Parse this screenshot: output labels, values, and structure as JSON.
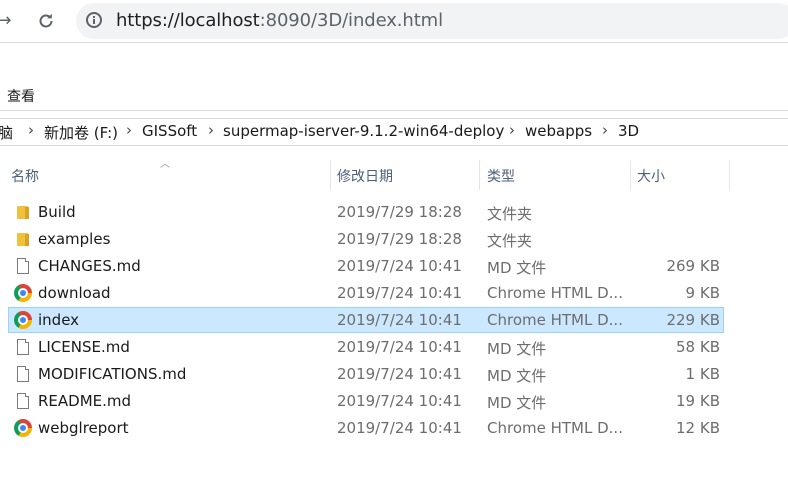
{
  "browser": {
    "back_icon": "arrow-left-icon",
    "reload_icon": "reload-icon",
    "info_icon": "info-icon",
    "url_scheme_host": "https://localhost",
    "url_rest": ":8090/3D/index.html"
  },
  "ribbon": {
    "view_tab": "查看"
  },
  "breadcrumb": {
    "items": [
      "脑",
      "新加卷 (F:)",
      "GISSoft",
      "supermap-iserver-9.1.2-win64-deploy",
      "webapps",
      "3D"
    ]
  },
  "columns": {
    "name": "名称",
    "date": "修改日期",
    "type": "类型",
    "size": "大小"
  },
  "files": [
    {
      "icon": "folder-icon",
      "name": "Build",
      "date": "2019/7/29 18:28",
      "type": "文件夹",
      "size": ""
    },
    {
      "icon": "folder-icon",
      "name": "examples",
      "date": "2019/7/29 18:28",
      "type": "文件夹",
      "size": ""
    },
    {
      "icon": "file-icon",
      "name": "CHANGES.md",
      "date": "2019/7/24 10:41",
      "type": "MD 文件",
      "size": "269 KB"
    },
    {
      "icon": "chrome-icon",
      "name": "download",
      "date": "2019/7/24 10:41",
      "type": "Chrome HTML D...",
      "size": "9 KB"
    },
    {
      "icon": "chrome-icon",
      "name": "index",
      "date": "2019/7/24 10:41",
      "type": "Chrome HTML D...",
      "size": "229 KB",
      "selected": true
    },
    {
      "icon": "file-icon",
      "name": "LICENSE.md",
      "date": "2019/7/24 10:41",
      "type": "MD 文件",
      "size": "58 KB"
    },
    {
      "icon": "file-icon",
      "name": "MODIFICATIONS.md",
      "date": "2019/7/24 10:41",
      "type": "MD 文件",
      "size": "1 KB"
    },
    {
      "icon": "file-icon",
      "name": "README.md",
      "date": "2019/7/24 10:41",
      "type": "MD 文件",
      "size": "19 KB"
    },
    {
      "icon": "chrome-icon",
      "name": "webglreport",
      "date": "2019/7/24 10:41",
      "type": "Chrome HTML D...",
      "size": "12 KB"
    }
  ],
  "colors": {
    "selection": "#cce8ff",
    "selection_border": "#99d1ff",
    "header_text": "#4c607a"
  }
}
